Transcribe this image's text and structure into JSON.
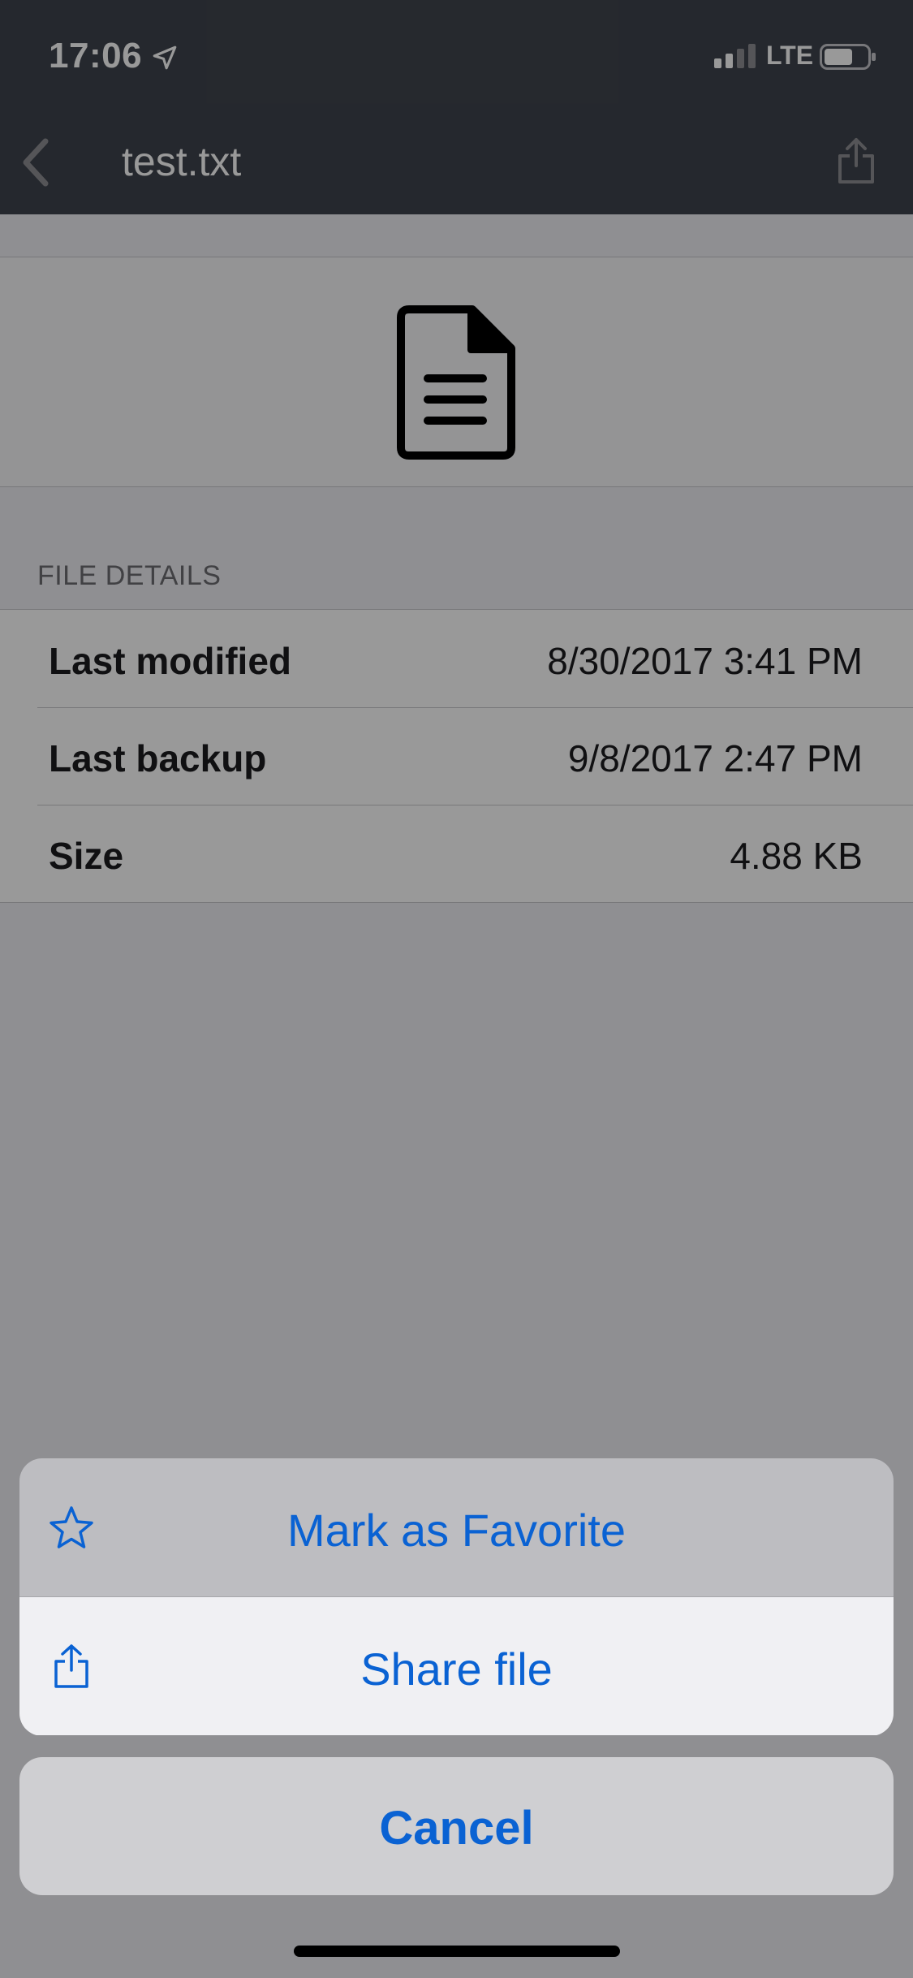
{
  "status_bar": {
    "time": "17:06",
    "network": "LTE",
    "icons": [
      "location-arrow-icon",
      "cellular-signal-icon",
      "battery-icon"
    ]
  },
  "nav": {
    "title": "test.txt",
    "icons": [
      "back-chevron-icon",
      "share-icon"
    ]
  },
  "file_preview": {
    "icon": "document-icon"
  },
  "details": {
    "section_header": "FILE DETAILS",
    "rows": [
      {
        "label": "Last modified",
        "value": "8/30/2017 3:41 PM"
      },
      {
        "label": "Last backup",
        "value": "9/8/2017 2:47 PM"
      },
      {
        "label": "Size",
        "value": "4.88 KB"
      }
    ]
  },
  "action_sheet": {
    "actions": [
      {
        "label": "Mark as Favorite",
        "icon": "star-icon"
      },
      {
        "label": "Share file",
        "icon": "share-icon"
      }
    ],
    "cancel_label": "Cancel"
  },
  "colors": {
    "accent": "#0a62d3",
    "nav_background": "#3f444d",
    "highlighted_action": "#f0f0f3"
  }
}
